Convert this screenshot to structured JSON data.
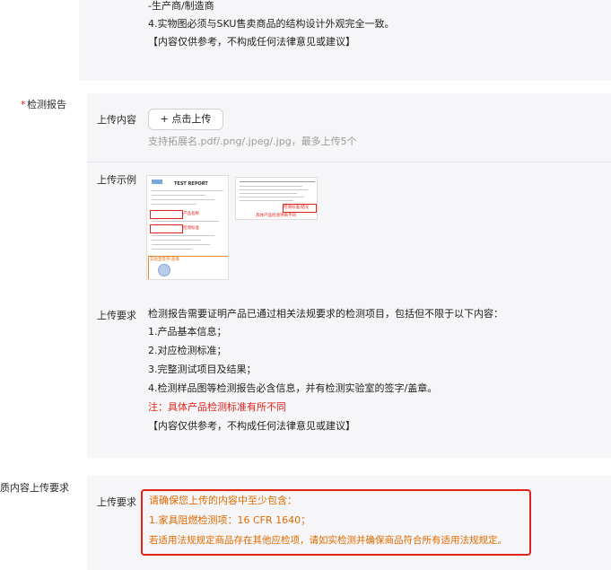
{
  "top_section": {
    "lines": [
      "-生产商/制造商",
      "4.实物图必须与SKU售卖商品的结构设计外观完全一致。",
      "【内容仅供参考，不构成任何法律意见或建议】"
    ]
  },
  "test_report": {
    "required_mark": "*",
    "label": "检测报告",
    "upload_content_label": "上传内容",
    "upload_button_label": "+ 点击上传",
    "upload_hint": "支持拓展名.pdf/.png/.jpeg/.jpg，最多上传5个",
    "example_label": "上传示例",
    "example_images": {
      "report_title": "TEST REPORT",
      "caption_left_1": "产品名称",
      "caption_left_2": "检测标准",
      "caption_left_3": "实验室签字/盖章",
      "caption_right_1": "检测标准/结论",
      "caption_right_2": "具体产品检测项目不同"
    },
    "requirements_label": "上传要求",
    "requirements": [
      "检测报告需要证明产品已通过相关法规要求的检测项目，包括但不限于以下内容：",
      "1.产品基本信息；",
      "2.对应检测标准；",
      "3.完整测试项目及结果；",
      "4.检测样品图等检测报告必含信息，并有检测实验室的签字/盖章。"
    ],
    "note": "注：具体产品检测标准有所不同",
    "disclaimer": "【内容仅供参考，不构成任何法律意见或建议】"
  },
  "qualification": {
    "label": "质内容上传要求",
    "requirements_label": "上传要求",
    "notice_lines": [
      "请确保您上传的内容中至少包含：",
      "1.家具阻燃检测项：16 CFR 1640；",
      "若适用法规规定商品存在其他应检项，请如实检测并确保商品符合所有适用法规规定。"
    ]
  },
  "colors": {
    "required": "#e2231a",
    "warning_text": "#e06a00",
    "notice_border": "#e2231a",
    "panel_bg": "#f6f6f8"
  }
}
